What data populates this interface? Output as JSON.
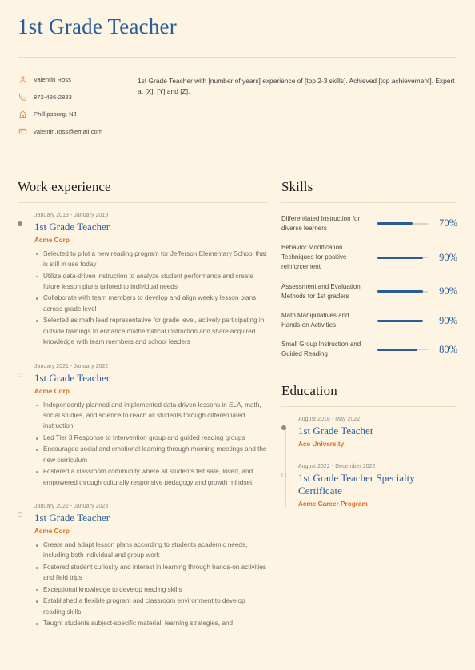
{
  "theme": {
    "background": "#fdf4e3",
    "accent_blue": "#2a5d96",
    "accent_orange": "#de6a23",
    "rule": "#e7dcc4",
    "body_text": "#6c6a64"
  },
  "header": {
    "title": "1st Grade Teacher"
  },
  "contact": {
    "items": [
      {
        "icon": "person-icon",
        "value": "Valentin Ross"
      },
      {
        "icon": "phone-icon",
        "value": "872-486-2883"
      },
      {
        "icon": "location-icon",
        "value": "Phillipsburg, NJ"
      },
      {
        "icon": "email-icon",
        "value": "valentin.ross@email.com"
      }
    ]
  },
  "summary": {
    "text": "1st Grade Teacher with [number of years] experience of [top 2-3 skills]. Achieved [top achievement]. Expert at [X], [Y] and [Z]."
  },
  "work_experience": {
    "heading": "Work experience",
    "entries": [
      {
        "date": "January 2018 - January 2019",
        "title": "1st Grade Teacher",
        "organization": "Acme Corp",
        "marker": "filled",
        "bullets": [
          "Selected to pilot a new reading program for Jefferson Elementary School that is still in use today",
          "Utilize data-driven instruction to analyze student performance and create future lesson plans tailored to individual needs",
          "Collaborate with team members to develop and align weekly lesson plans across grade level",
          "Selected as math lead representative for grade level, actively participating in outside trainings to enhance mathematical instruction and share acquired knowledge with team members and school leaders"
        ]
      },
      {
        "date": "January 2021 - January 2022",
        "title": "1st Grade Teacher",
        "organization": "Acme Corp",
        "marker": "hollow",
        "bullets": [
          "Independently planned and implemented data-driven lessons in ELA, math, social studies, and science to reach all students through differentiated instruction",
          "Led Tier 3 Response to Intervention group and guided reading groups",
          "Encouraged social and emotional learning through morning meetings and the new curriculum",
          "Fostered a classroom community where all students felt safe, loved, and empowered through culturally responsive pedagogy and growth mindset"
        ]
      },
      {
        "date": "January 2022 - January 2023",
        "title": "1st Grade Teacher",
        "organization": "Acme Corp",
        "marker": "hollow",
        "bullets": [
          "Create and adapt lesson plans according to students academic needs, including both individual and group work",
          "Fostered student curiosity and interest in learning through hands-on activities and field trips",
          "Exceptional knowledge to develop reading skills",
          "Established a flexible program and classroom environment to develop reading skills",
          "Taught students subject-specific material, learning strategies, and"
        ]
      }
    ]
  },
  "skills": {
    "heading": "Skills",
    "items": [
      {
        "name": "Differentiated Instruction for diverse learners",
        "level": 70,
        "level_label": "70%"
      },
      {
        "name": "Behavior Modification Techniques for positive reinforcement",
        "level": 90,
        "level_label": "90%"
      },
      {
        "name": "Assessment and Evaluation Methods for 1st graders",
        "level": 90,
        "level_label": "90%"
      },
      {
        "name": "Math Manipulatives and Hands-on Activities",
        "level": 90,
        "level_label": "90%"
      },
      {
        "name": "Small Group Instruction and Guided Reading",
        "level": 80,
        "level_label": "80%"
      }
    ]
  },
  "education": {
    "heading": "Education",
    "entries": [
      {
        "date": "August 2018 - May 2022",
        "title": "1st Grade Teacher",
        "organization": "Ace University",
        "marker": "filled"
      },
      {
        "date": "August 2022 - December 2022",
        "title": "1st Grade Teacher Specialty Certificate",
        "organization": "Acme Career Program",
        "marker": "hollow"
      }
    ]
  }
}
